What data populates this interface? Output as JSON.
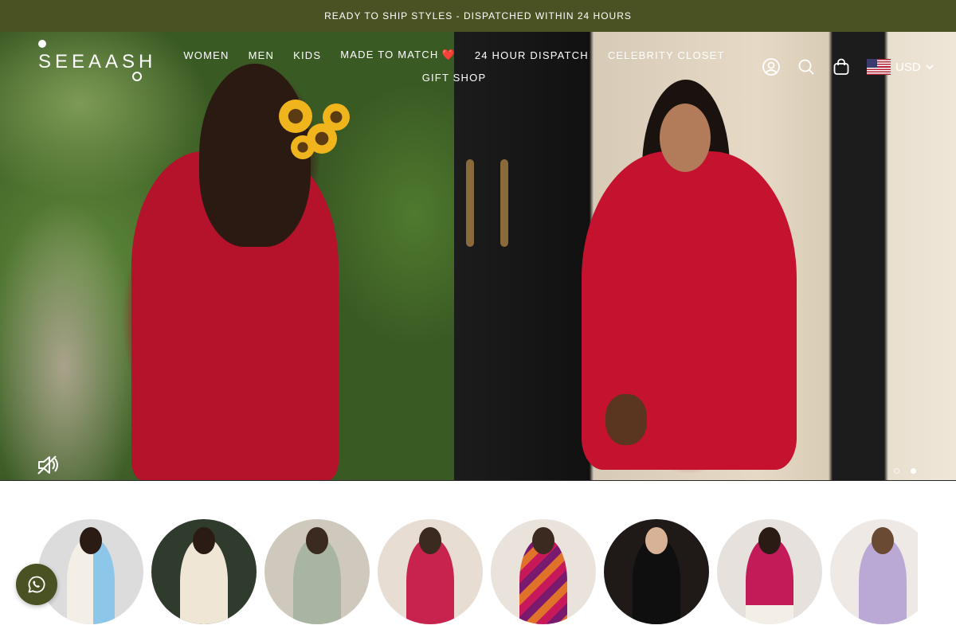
{
  "announcement": "READY TO SHIP STYLES - DISPATCHED WITHIN 24 HOURS",
  "brand": {
    "name": "SEEAASH"
  },
  "nav": {
    "row1": [
      "WOMEN",
      "MEN",
      "KIDS",
      "MADE TO MATCH",
      "24 HOUR DISPATCH",
      "CELEBRITY CLOSET"
    ],
    "made_to_match_emoji": "❤️",
    "row2": [
      "GIFT SHOP"
    ]
  },
  "header_icons": [
    "account-icon",
    "search-icon",
    "cart-icon"
  ],
  "currency": {
    "code": "USD",
    "flag": "us-flag-icon"
  },
  "hero": {
    "slides_count": 2,
    "active_slide": 2,
    "mute_icon": "speaker-muted-icon"
  },
  "categories": [
    {
      "name": "category-1",
      "bg": "#dcdcdc",
      "dress": "#f3efe6"
    },
    {
      "name": "category-2",
      "bg": "#2f3b2c",
      "dress": "#efe6d6"
    },
    {
      "name": "category-3",
      "bg": "#cfc9bd",
      "dress": "#a9b5a3"
    },
    {
      "name": "category-4",
      "bg": "#e8ddd3",
      "dress": "#c8234f"
    },
    {
      "name": "category-5",
      "bg": "#e9e3dc",
      "dress": "#c7185a"
    },
    {
      "name": "category-6",
      "bg": "#1f1a18",
      "dress": "#0f0f0f"
    },
    {
      "name": "category-7",
      "bg": "#e6e1dc",
      "dress": "#c21b57"
    },
    {
      "name": "category-8",
      "bg": "#efe9e6",
      "dress": "#b9a9d4"
    }
  ],
  "whatsapp": {
    "icon": "whatsapp-icon"
  },
  "colors": {
    "announce_bg": "#4a5224",
    "accent_red": "#c4122f",
    "white": "#ffffff"
  }
}
